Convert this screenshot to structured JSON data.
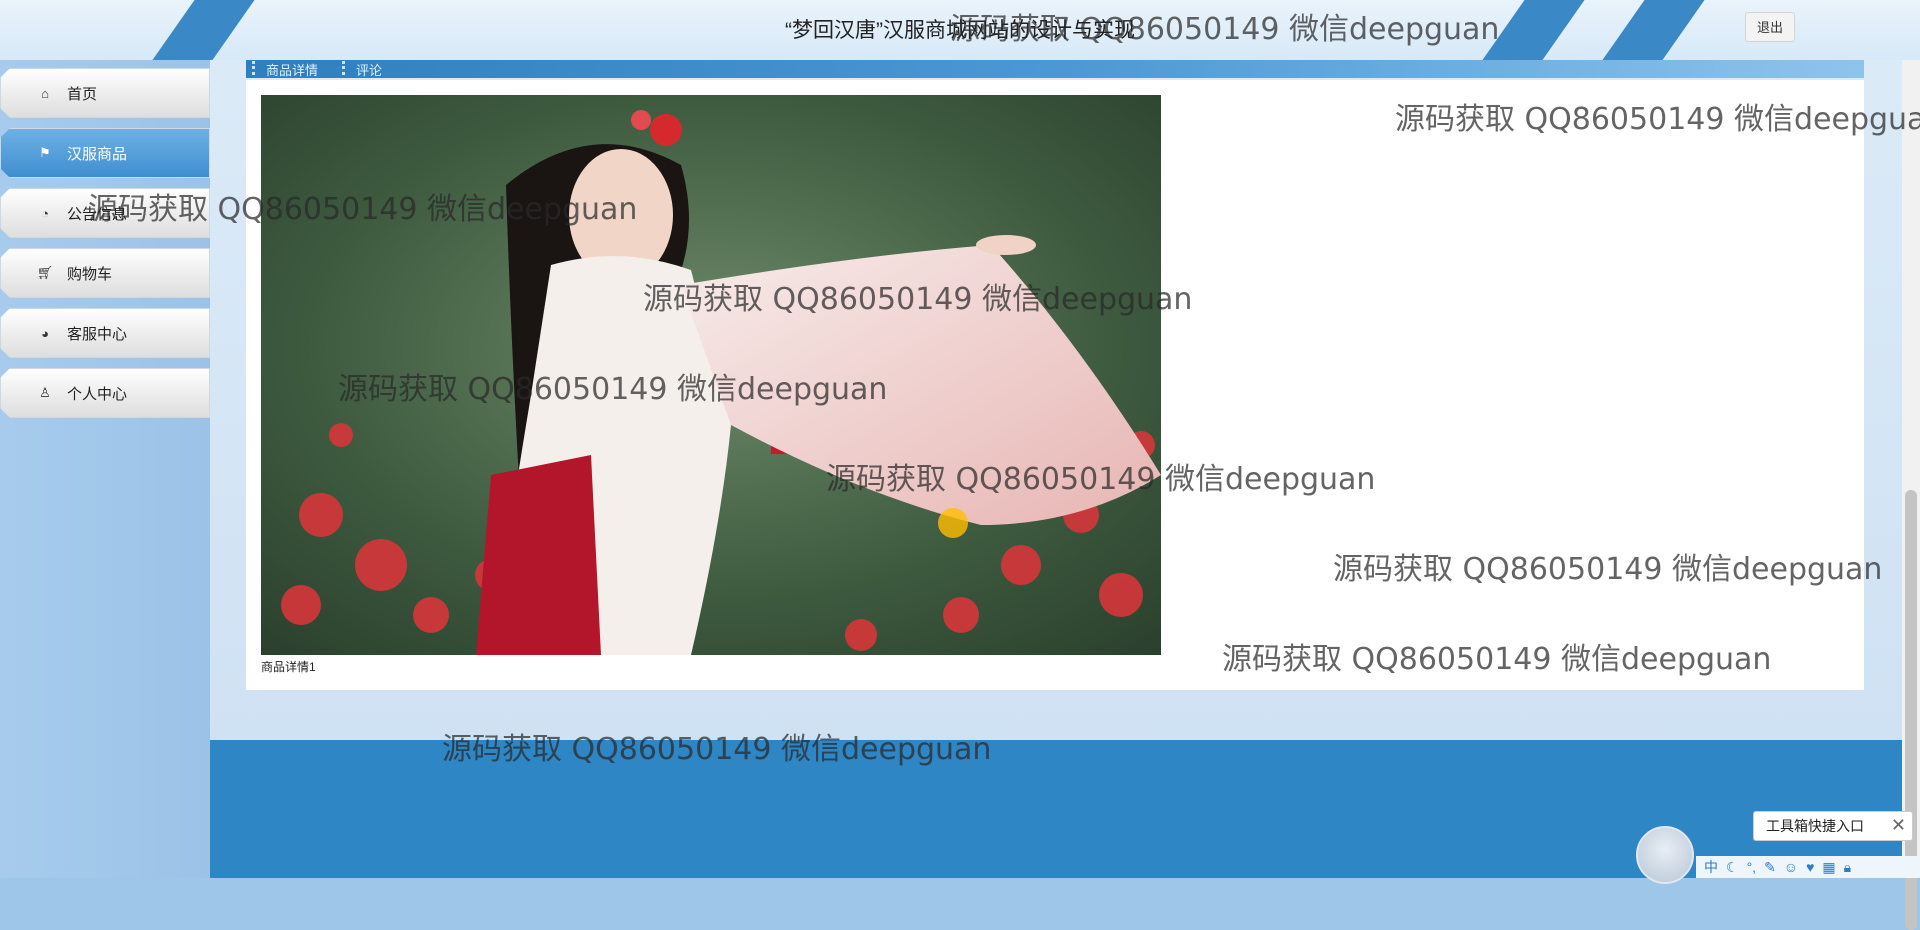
{
  "header": {
    "title": "“梦回汉唐”汉服商城网站的设计与实现",
    "logout_label": "退出"
  },
  "sidebar": {
    "items": [
      {
        "label": "首页",
        "icon": "home-icon",
        "active": false
      },
      {
        "label": "汉服商品",
        "icon": "flag-icon",
        "active": true
      },
      {
        "label": "公告信息",
        "icon": "gauge-icon",
        "active": false
      },
      {
        "label": "购物车",
        "icon": "cart-icon",
        "active": false
      },
      {
        "label": "客服中心",
        "icon": "service-icon",
        "active": false
      },
      {
        "label": "个人中心",
        "icon": "user-icon",
        "active": false
      }
    ]
  },
  "main": {
    "tabs": [
      {
        "label": "商品详情"
      },
      {
        "label": "评论"
      }
    ],
    "image_caption": "商品详情1"
  },
  "watermark": {
    "text": "源码获取 QQ86050149 微信deepguan"
  },
  "toolbox": {
    "label": "工具箱快捷入口",
    "close": "✕"
  },
  "ime": {
    "mode": "中"
  },
  "colors": {
    "accent": "#3a89c6",
    "active_nav": "#4a95d3",
    "footer": "#2f86c5"
  }
}
